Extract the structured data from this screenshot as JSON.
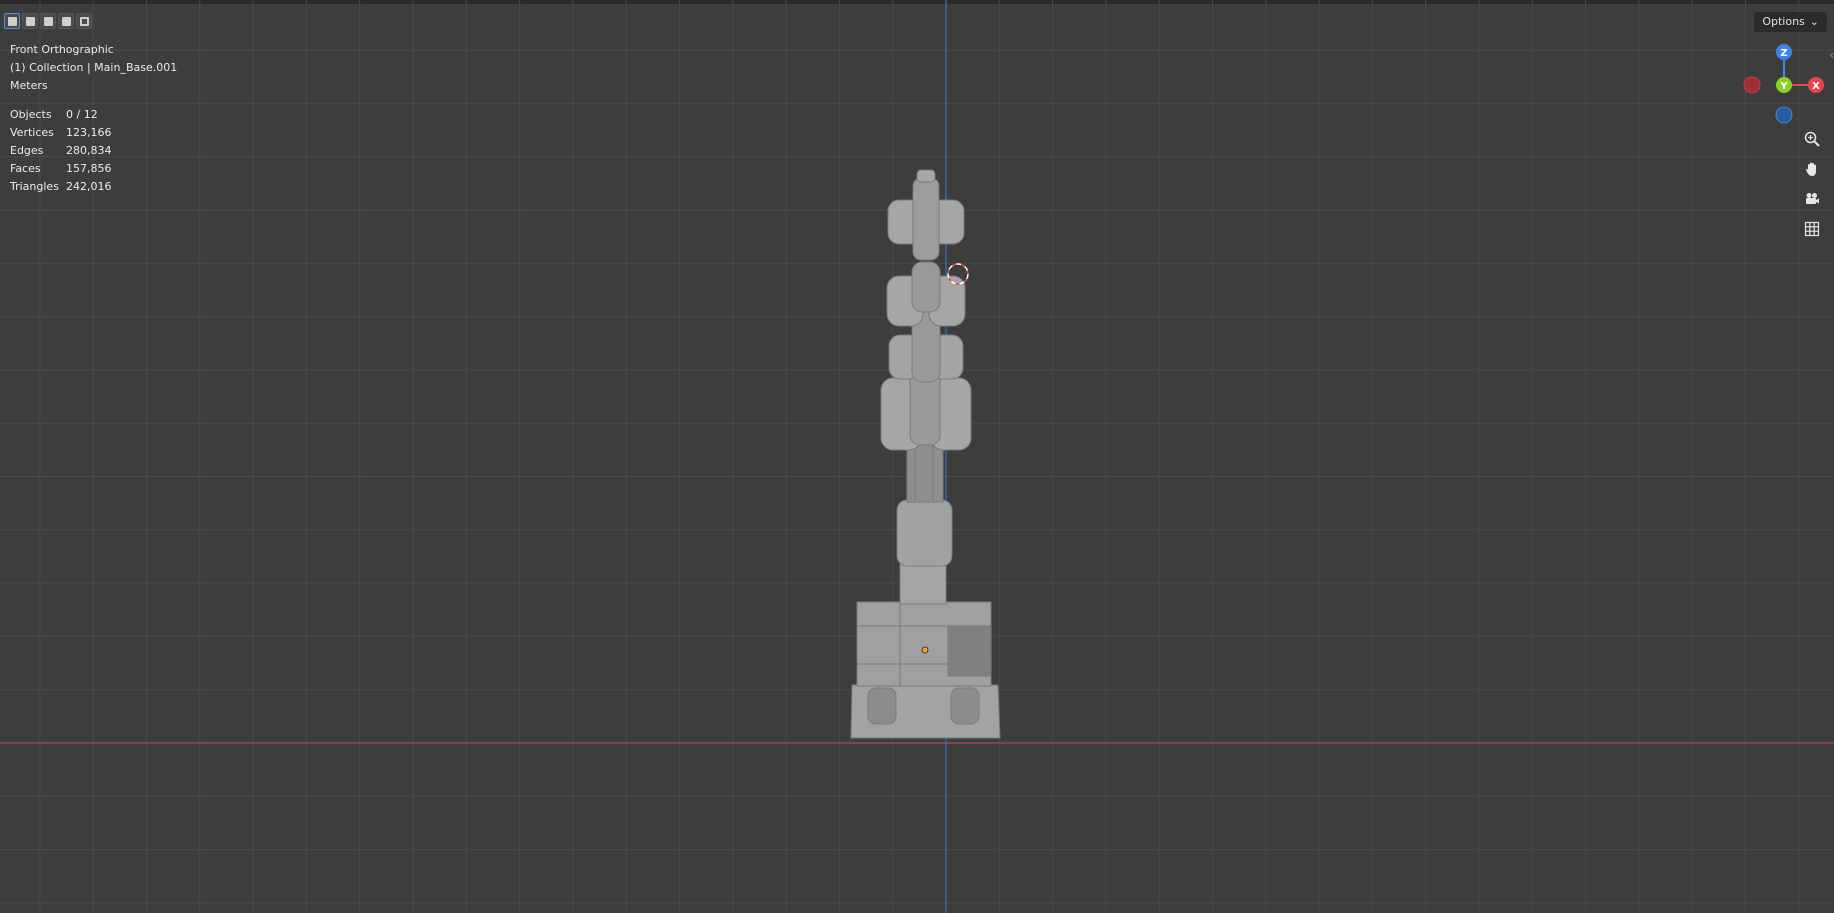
{
  "viewport": {
    "view_name": "Front Orthographic",
    "collection_line": "(1) Collection | Main_Base.001",
    "units": "Meters",
    "stats": [
      {
        "label": "Objects",
        "value": "0 / 12"
      },
      {
        "label": "Vertices",
        "value": "123,166"
      },
      {
        "label": "Edges",
        "value": "280,834"
      },
      {
        "label": "Faces",
        "value": "157,856"
      },
      {
        "label": "Triangles",
        "value": "242,016"
      }
    ],
    "options_label": "Options",
    "gizmo": {
      "z": "Z",
      "y": "Y",
      "x": "X"
    },
    "colors": {
      "background": "#3d3d3d",
      "x_axis": "#c9394a",
      "z_axis": "#3b6fb8",
      "gizmo_x": "#e8434f",
      "gizmo_y": "#8bd327",
      "gizmo_z": "#3f86e3",
      "model": "#9e9e9e"
    }
  },
  "nav_tools": [
    {
      "name": "zoom-icon"
    },
    {
      "name": "pan-hand-icon"
    },
    {
      "name": "camera-icon"
    },
    {
      "name": "grid-ortho-icon"
    }
  ],
  "selection_modes": [
    {
      "name": "select-new-icon",
      "active": true
    },
    {
      "name": "select-extend-icon",
      "active": false
    },
    {
      "name": "select-subtract-icon",
      "active": false
    },
    {
      "name": "select-invert-icon",
      "active": false
    },
    {
      "name": "select-intersect-icon",
      "active": false
    }
  ]
}
